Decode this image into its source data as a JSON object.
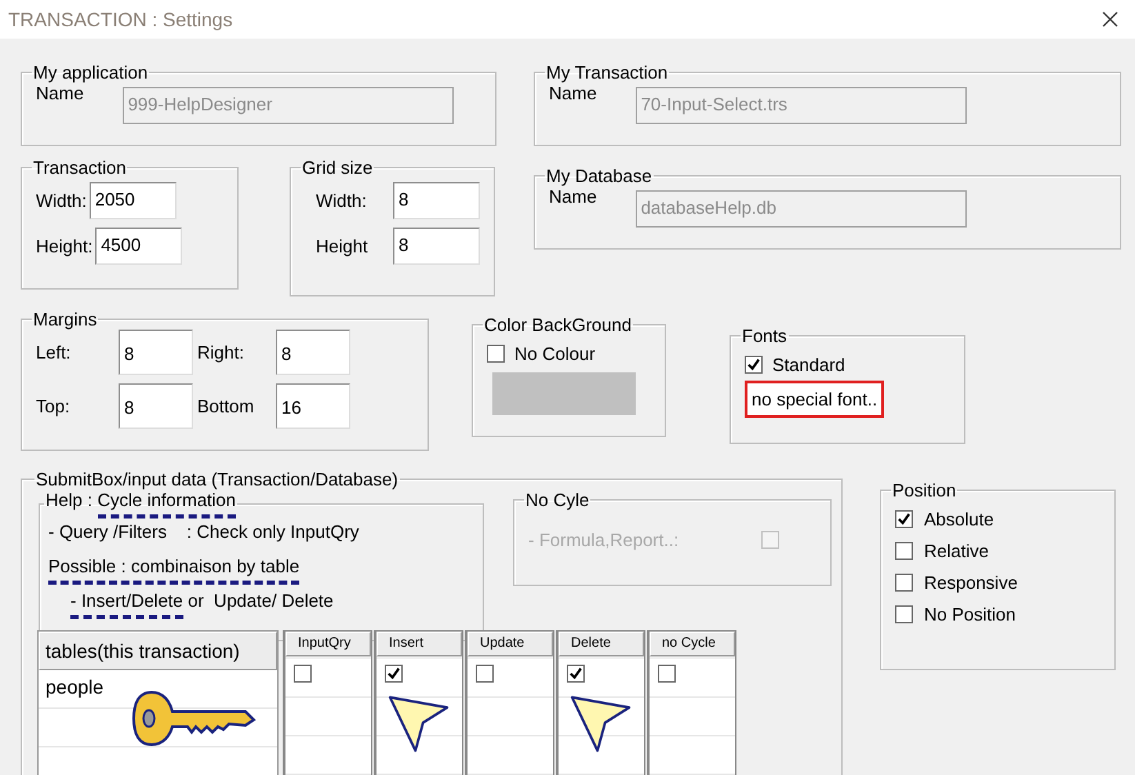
{
  "window": {
    "title": "TRANSACTION : Settings"
  },
  "my_application": {
    "title": "My application",
    "label": "Name",
    "value": "999-HelpDesigner",
    "disabled": true
  },
  "my_transaction": {
    "title": "My Transaction",
    "label": "Name",
    "value": "70-Input-Select.trs",
    "disabled": true
  },
  "my_database": {
    "title": "My  Database",
    "label": "Name",
    "value": "databaseHelp.db",
    "disabled": true
  },
  "transaction": {
    "title": "Transaction",
    "fields": [
      {
        "label": "Width:",
        "value": "2050"
      },
      {
        "label": "Height:",
        "value": "4500"
      }
    ]
  },
  "grid_size": {
    "title": "Grid size",
    "fields": [
      {
        "label": "Width:",
        "value": "8"
      },
      {
        "label": "Height",
        "value": "8"
      }
    ]
  },
  "margins": {
    "title": "Margins",
    "fields": [
      {
        "label": "Left:",
        "value": "8"
      },
      {
        "label": "Right:",
        "value": "8"
      },
      {
        "label": "Top:",
        "value": "8"
      },
      {
        "label": "Bottom",
        "value": "16"
      }
    ]
  },
  "color_background": {
    "title": "Color BackGround",
    "checkbox": {
      "label": "No Colour",
      "checked": false
    }
  },
  "fonts": {
    "title": "Fonts",
    "checkbox": {
      "label": "Standard",
      "checked": true
    },
    "note": "no special font.."
  },
  "submit_box": {
    "title": "SubmitBox/input data (Transaction/Database)",
    "help": {
      "title": [
        {
          "text": "Help : ",
          "marked": false
        },
        {
          "text": "Cycle information",
          "marked": true
        }
      ],
      "lines": [
        {
          "parts": [
            {
              "text": "- Query /Filters    : Check only InputQry",
              "marked": false
            }
          ]
        },
        {
          "parts": [
            {
              "text": "Possible : combinaison by table",
              "marked": true
            }
          ]
        },
        {
          "parts": [
            {
              "text": "- Insert/Delete",
              "marked": true
            },
            {
              "text": " or  Update/ Delete",
              "marked": false
            }
          ]
        }
      ]
    },
    "no_cycle": {
      "title": "No Cyle",
      "label": "- Formula,Report..:",
      "checked": false,
      "disabled": true
    },
    "table": {
      "columns": [
        "tables(this transaction)",
        "InputQry",
        "Insert",
        "Update",
        "Delete",
        "no Cycle"
      ],
      "rows": [
        {
          "table": "people",
          "checks": [
            false,
            true,
            false,
            true,
            false
          ]
        }
      ]
    }
  },
  "position": {
    "title": "Position",
    "options": [
      {
        "label": "Absolute",
        "checked": true
      },
      {
        "label": "Relative",
        "checked": false
      },
      {
        "label": "Responsive",
        "checked": false
      },
      {
        "label": "No Position",
        "checked": false
      }
    ]
  }
}
